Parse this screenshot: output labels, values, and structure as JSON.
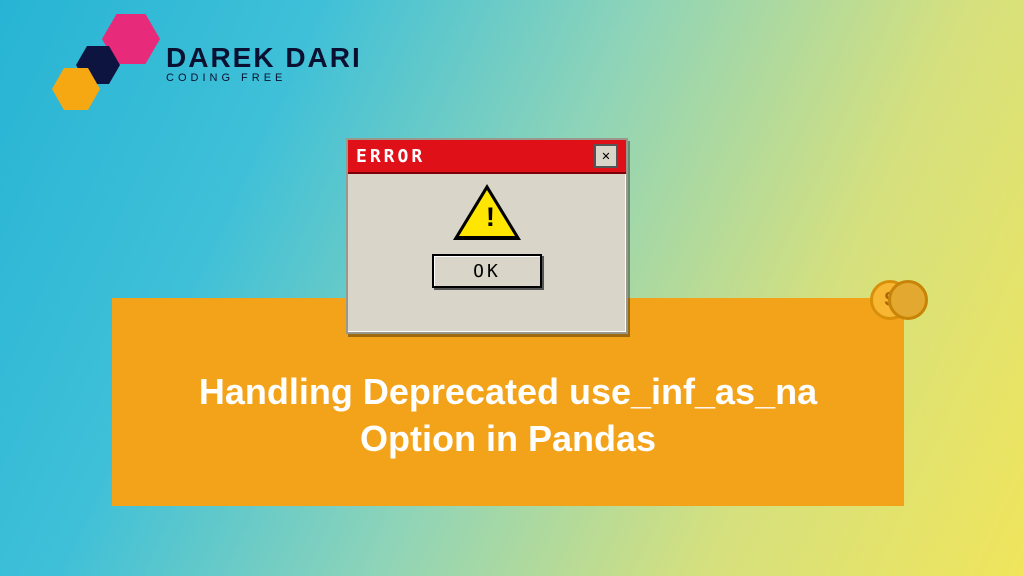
{
  "logo": {
    "title": "DAREK DARI",
    "subtitle": "CODING FREE"
  },
  "dialog": {
    "title": "ERROR",
    "close_glyph": "✕",
    "bang": "!",
    "ok_label": "OK"
  },
  "banner": {
    "text": "Handling Deprecated use_inf_as_na Option in Pandas"
  },
  "coin": {
    "symbol": "$"
  }
}
